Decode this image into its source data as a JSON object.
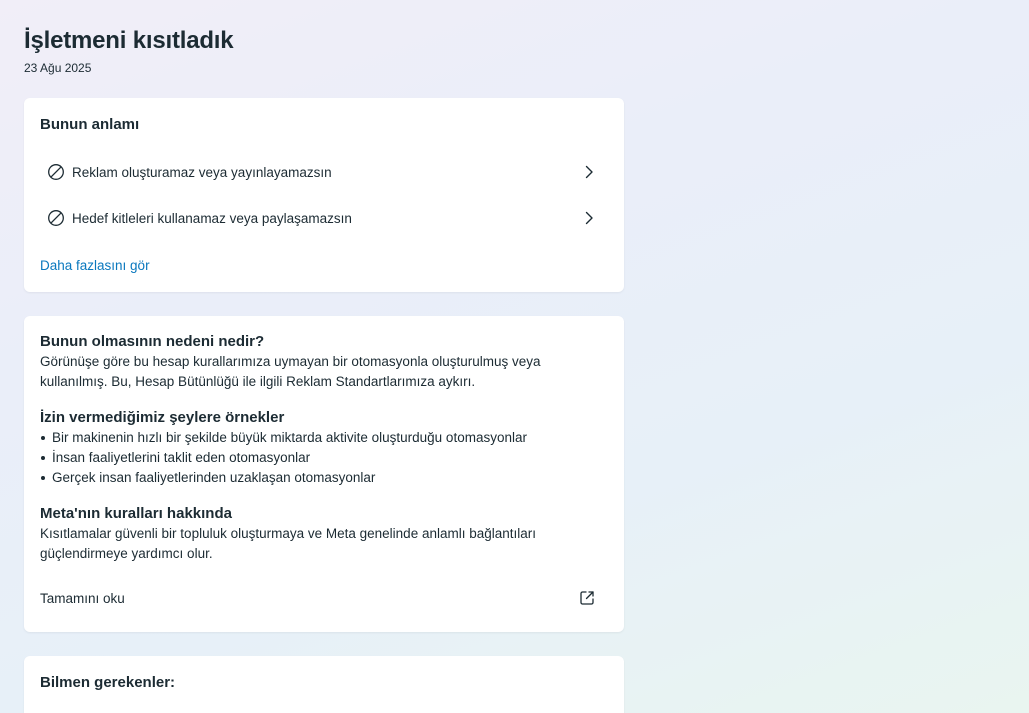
{
  "header": {
    "title": "İşletmeni kısıtladık",
    "date": "23 Ağu 2025"
  },
  "meaning": {
    "heading": "Bunun anlamı",
    "items": [
      {
        "label": "Reklam oluşturamaz veya yayınlayamazsın",
        "icon": "ban-icon"
      },
      {
        "label": "Hedef kitleleri kullanamaz veya paylaşamazsın",
        "icon": "ban-icon"
      }
    ],
    "see_more": "Daha fazlasını gör"
  },
  "reason": {
    "heading": "Bunun olmasının nedeni nedir?",
    "text": "Görünüşe göre bu hesap kurallarımıza uymayan bir otomasyonla oluşturulmuş veya kullanılmış. Bu, Hesap Bütünlüğü ile ilgili Reklam Standartlarımıza aykırı.",
    "examples_heading": "İzin vermediğimiz şeylere örnekler",
    "examples": [
      "Bir makinenin hızlı bir şekilde büyük miktarda aktivite oluşturduğu otomasyonlar",
      "İnsan faaliyetlerini taklit eden otomasyonlar",
      "Gerçek insan faaliyetlerinden uzaklaşan otomasyonlar"
    ],
    "rules_heading": "Meta'nın kuralları hakkında",
    "rules_text": "Kısıtlamalar güvenli bir topluluk oluşturmaya ve Meta genelinde anlamlı bağlantıları güçlendirmeye yardımcı olur.",
    "read_all": "Tamamını oku"
  },
  "know": {
    "heading": "Bilmen gerekenler:"
  },
  "colors": {
    "link": "#0a78be",
    "text": "#1c2b33",
    "card": "#ffffff"
  }
}
